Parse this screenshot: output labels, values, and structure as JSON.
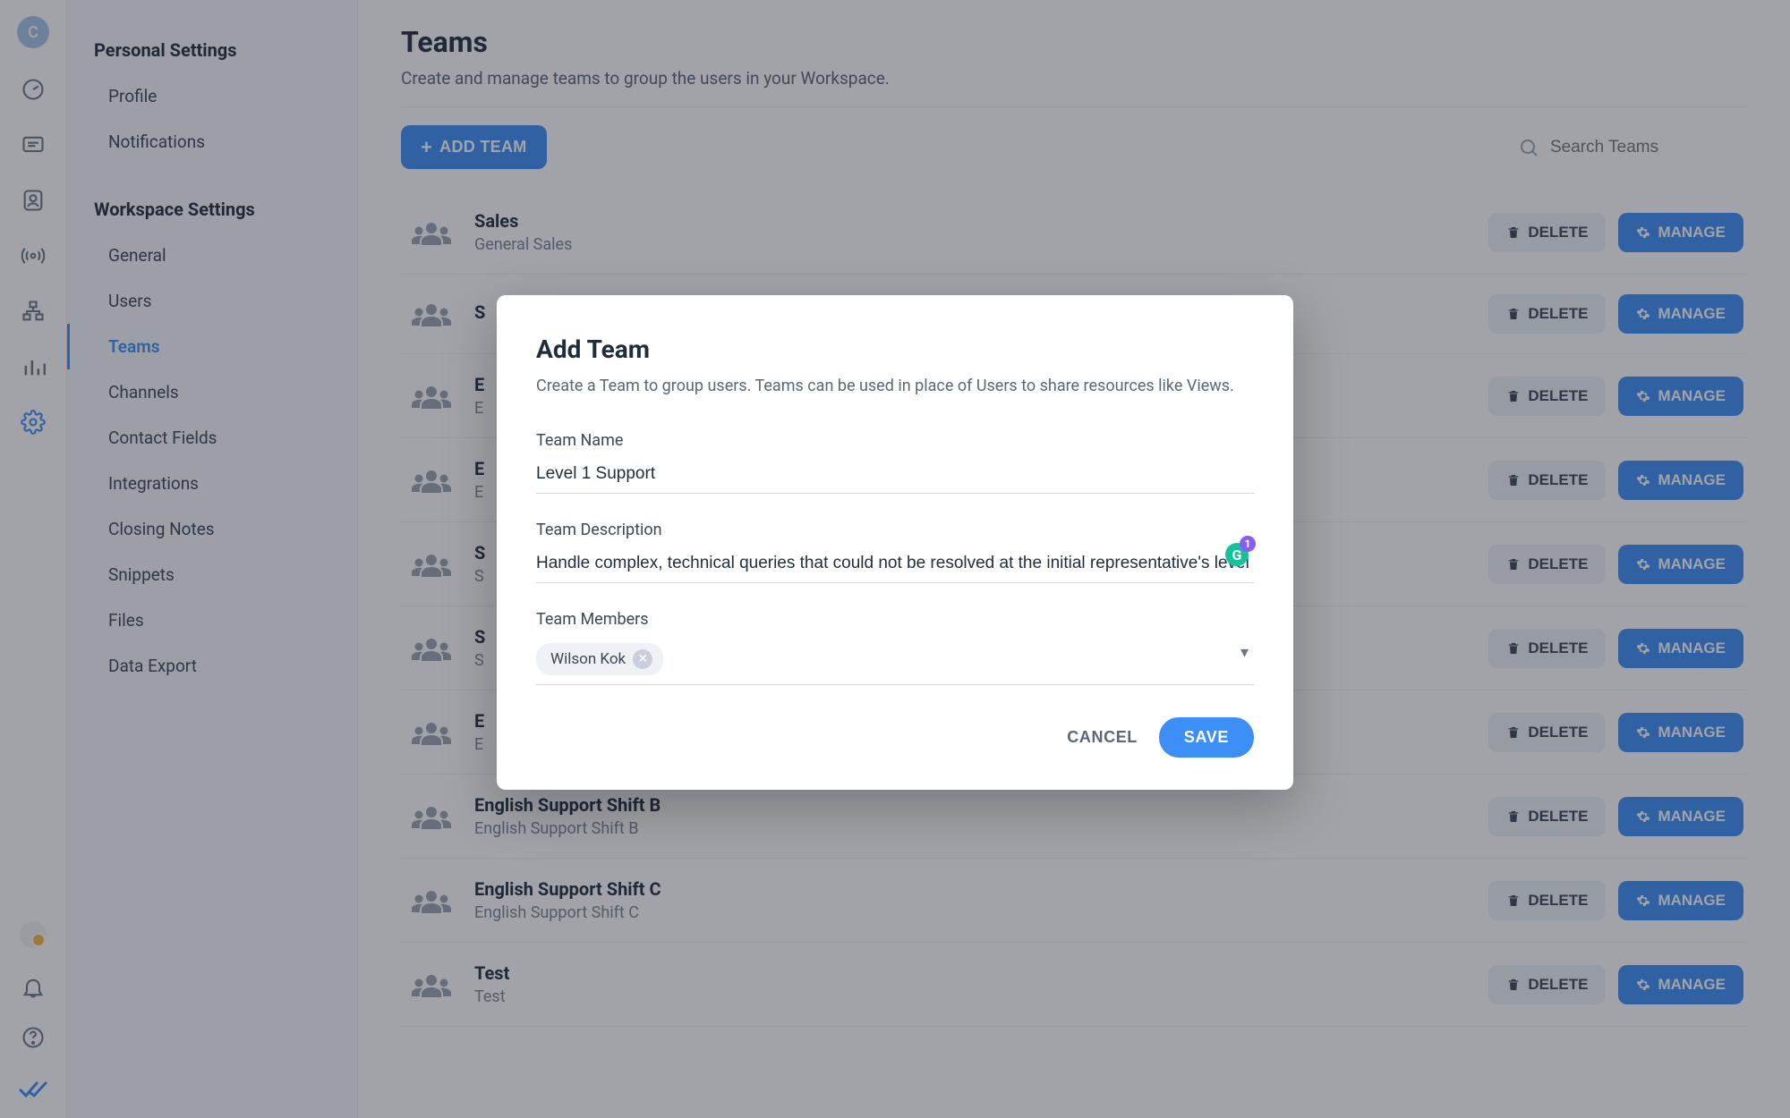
{
  "avatar_initial": "C",
  "sidebar": {
    "personal_title": "Personal Settings",
    "workspace_title": "Workspace Settings",
    "personal_items": [
      "Profile",
      "Notifications"
    ],
    "workspace_items": [
      "General",
      "Users",
      "Teams",
      "Channels",
      "Contact Fields",
      "Integrations",
      "Closing Notes",
      "Snippets",
      "Files",
      "Data Export"
    ],
    "active_item": "Teams"
  },
  "page": {
    "title": "Teams",
    "subtitle": "Create and manage teams to group the users in your Workspace.",
    "add_button": "ADD TEAM",
    "search_placeholder": "Search Teams"
  },
  "buttons": {
    "delete": "DELETE",
    "manage": "MANAGE"
  },
  "teams": [
    {
      "name": "Sales",
      "desc": "General Sales"
    },
    {
      "name": "S",
      "desc": ""
    },
    {
      "name": "E",
      "desc": "E"
    },
    {
      "name": "E",
      "desc": "E"
    },
    {
      "name": "S",
      "desc": "S"
    },
    {
      "name": "S",
      "desc": "S"
    },
    {
      "name": "E",
      "desc": "E"
    },
    {
      "name": "English Support Shift B",
      "desc": "English Support Shift B"
    },
    {
      "name": "English Support Shift C",
      "desc": "English Support Shift C"
    },
    {
      "name": "Test",
      "desc": "Test"
    }
  ],
  "modal": {
    "title": "Add Team",
    "subtitle": "Create a Team to group users. Teams can be used in place of Users to share resources like Views.",
    "name_label": "Team Name",
    "name_value": "Level 1 Support",
    "desc_label": "Team Description",
    "desc_value": "Handle complex, technical queries that could not be resolved at the initial representative's level",
    "members_label": "Team Members",
    "member_chip": "Wilson Kok",
    "cancel": "CANCEL",
    "save": "SAVE"
  }
}
